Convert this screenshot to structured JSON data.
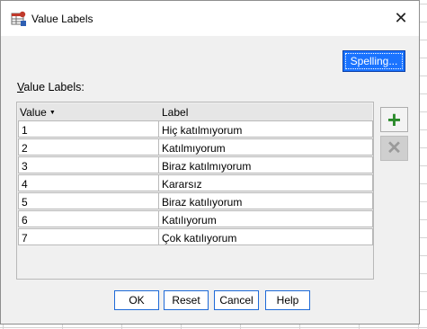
{
  "window": {
    "title": "Value Labels",
    "close_glyph": "✕"
  },
  "toolbar": {
    "spelling_label": "Spelling..."
  },
  "section": {
    "label_prefix": "V",
    "label_rest": "alue Labels:"
  },
  "table": {
    "columns": [
      "Value",
      "Label"
    ],
    "rows": [
      {
        "value": "1",
        "label": "Hiç katılmıyorum"
      },
      {
        "value": "2",
        "label": "Katılmıyorum"
      },
      {
        "value": "3",
        "label": "Biraz katılmıyorum"
      },
      {
        "value": "4",
        "label": "Kararsız"
      },
      {
        "value": "5",
        "label": "Biraz katılıyorum"
      },
      {
        "value": "6",
        "label": "Katılıyorum"
      },
      {
        "value": "7",
        "label": "Çok katılıyorum"
      }
    ]
  },
  "side_buttons": {
    "add_glyph": "+",
    "delete_glyph": "✕"
  },
  "buttons": {
    "ok": "OK",
    "reset": "Reset",
    "cancel": "Cancel",
    "help": "Help"
  },
  "colors": {
    "accent": "#1a73ff",
    "add_green": "#2a8a2a"
  },
  "icons": {
    "app": "spss-value-labels-icon",
    "close": "close-icon",
    "sort": "sort-down-icon",
    "add": "add-icon",
    "delete": "delete-icon"
  }
}
